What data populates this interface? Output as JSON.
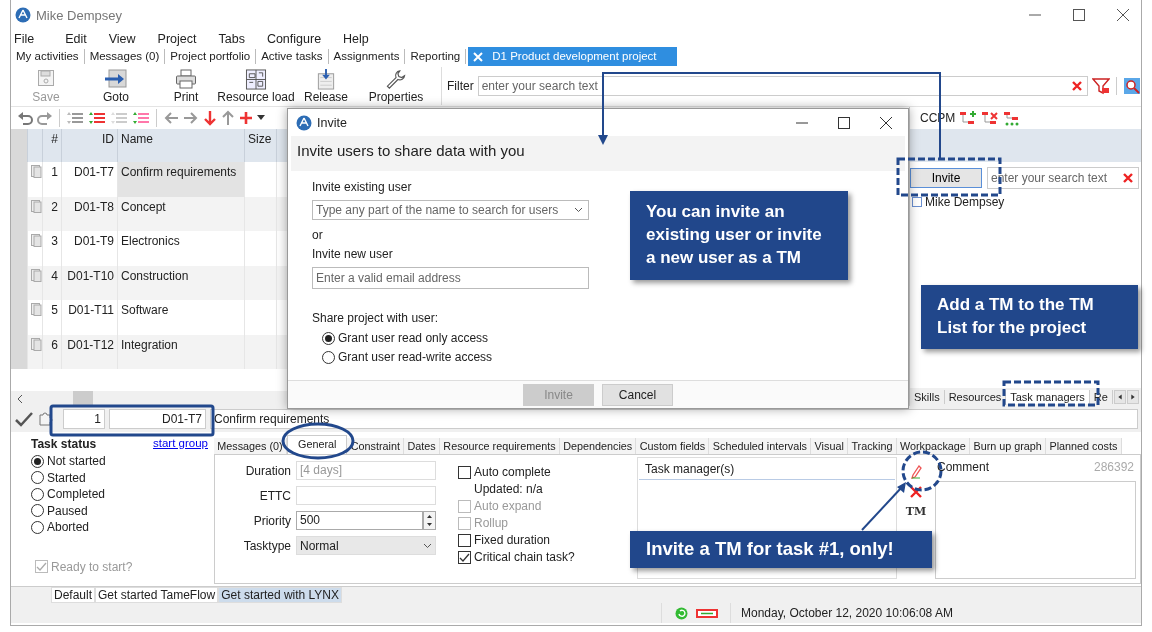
{
  "window": {
    "title": "Mike Dempsey"
  },
  "menu": [
    "File",
    "Edit",
    "View",
    "Project",
    "Tabs",
    "Configure",
    "Help"
  ],
  "tabs": [
    {
      "label": "My activities",
      "selected": false
    },
    {
      "label": "Messages (0)",
      "selected": false
    },
    {
      "label": "Project portfolio",
      "selected": false
    },
    {
      "label": "Active tasks",
      "selected": false
    },
    {
      "label": "Assignments",
      "selected": false
    },
    {
      "label": "Reporting",
      "selected": false
    },
    {
      "label": "D1 Product development project",
      "selected": true
    }
  ],
  "toolbar": [
    {
      "kind": "save",
      "label": "Save",
      "disabled": true
    },
    {
      "kind": "goto",
      "label": "Goto",
      "disabled": false
    },
    {
      "kind": "print",
      "label": "Print",
      "disabled": false
    },
    {
      "kind": "resource_load",
      "label": "Resource load",
      "disabled": false
    },
    {
      "kind": "release",
      "label": "Release",
      "disabled": false
    },
    {
      "kind": "properties",
      "label": "Properties",
      "disabled": false
    }
  ],
  "filter": {
    "label": "Filter",
    "placeholder": "enter your search text"
  },
  "ccpm": {
    "label": "CCPM"
  },
  "table": {
    "columns": [
      "#",
      "ID",
      "Name",
      "Size"
    ],
    "rows": [
      {
        "num": "1",
        "id": "D01-T7",
        "name": "Confirm requirements",
        "selected": true
      },
      {
        "num": "2",
        "id": "D01-T8",
        "name": "Concept",
        "selected": false
      },
      {
        "num": "3",
        "id": "D01-T9",
        "name": "Electronics",
        "selected": false
      },
      {
        "num": "4",
        "id": "D01-T10",
        "name": "Construction",
        "selected": false
      },
      {
        "num": "5",
        "id": "D01-T11",
        "name": "Software",
        "selected": false
      },
      {
        "num": "6",
        "id": "D01-T12",
        "name": "Integration",
        "selected": false
      }
    ]
  },
  "team_panel": {
    "invite_button": "Invite",
    "search_placeholder": "enter your search text",
    "users": [
      {
        "name": "Mike Dempsey",
        "checked": false
      }
    ],
    "tabs": [
      {
        "label": "Skills",
        "selected": false
      },
      {
        "label": "Resources",
        "selected": false
      },
      {
        "label": "Task managers",
        "selected": true
      },
      {
        "label": "Re",
        "selected": false
      }
    ]
  },
  "task_editor": {
    "number": "1",
    "id": "D01-T7",
    "name": "Confirm requirements",
    "status_title": "Task status",
    "start_group": "start group",
    "statuses": [
      {
        "label": "Not started",
        "selected": true
      },
      {
        "label": "Started",
        "selected": false
      },
      {
        "label": "Completed",
        "selected": false
      },
      {
        "label": "Paused",
        "selected": false
      },
      {
        "label": "Aborted",
        "selected": false
      }
    ],
    "ready": {
      "label": "Ready to start?",
      "checked": true,
      "disabled": true
    },
    "tabs": [
      {
        "label": "Messages (0)",
        "selected": false
      },
      {
        "label": "General",
        "selected": true
      },
      {
        "label": "Constraint",
        "selected": false
      },
      {
        "label": "Dates",
        "selected": false
      },
      {
        "label": "Resource requirements",
        "selected": false
      },
      {
        "label": "Dependencies",
        "selected": false
      },
      {
        "label": "Custom fields",
        "selected": false
      },
      {
        "label": "Scheduled intervals",
        "selected": false
      },
      {
        "label": "Visual",
        "selected": false
      },
      {
        "label": "Tracking",
        "selected": false
      },
      {
        "label": "Workpackage",
        "selected": false
      },
      {
        "label": "Burn up graph",
        "selected": false
      },
      {
        "label": "Planned costs",
        "selected": false
      }
    ],
    "fields": [
      {
        "kind": "text",
        "label": "Duration",
        "placeholder": "[4 days]"
      },
      {
        "kind": "text",
        "label": "ETTC"
      },
      {
        "kind": "spin",
        "label": "Priority",
        "value": "500"
      },
      {
        "kind": "select",
        "label": "Tasktype",
        "value": "Normal"
      }
    ],
    "tm_button": "TM",
    "options": [
      {
        "label": "Auto complete",
        "checked": false,
        "disabled": false
      },
      {
        "label": "Auto expand",
        "checked": false,
        "disabled": true
      },
      {
        "label": "Rollup",
        "checked": false,
        "disabled": true
      },
      {
        "label": "Fixed duration",
        "checked": false,
        "disabled": false
      },
      {
        "label": "Critical chain task?",
        "checked": true,
        "disabled": false
      }
    ],
    "updated": "Updated: n/a",
    "task_managers": {
      "header": "Task manager(s)"
    },
    "comment": {
      "header": "Comment",
      "number": "286392"
    }
  },
  "views": [
    {
      "label": "Default",
      "selected": false
    },
    {
      "label": "Get started TameFlow",
      "selected": false
    },
    {
      "label": "Get started with LYNX",
      "selected": true
    }
  ],
  "status_bar": {
    "datetime": "Monday, October 12, 2020 10:06:08 AM"
  },
  "dialog": {
    "title": "Invite",
    "heading": "Invite users to share data with you",
    "existing_label": "Invite existing user",
    "existing_placeholder": "Type any part of the name to search for users",
    "or": "or",
    "new_label": "Invite new user",
    "new_placeholder": "Enter a valid email address",
    "share_label": "Share project with user:",
    "access": [
      {
        "label": "Grant user read only access",
        "selected": true
      },
      {
        "label": "Grant user read-write access",
        "selected": false
      }
    ],
    "buttons": [
      {
        "label": "Invite",
        "disabled": true
      },
      {
        "label": "Cancel",
        "disabled": false
      }
    ]
  },
  "callouts": [
    {
      "text": "You can invite an existing user or invite a new user as a TM"
    },
    {
      "text": "Add a TM to the **TM List** for the project"
    },
    {
      "text": "Invite a TM for task #1, only!"
    }
  ]
}
